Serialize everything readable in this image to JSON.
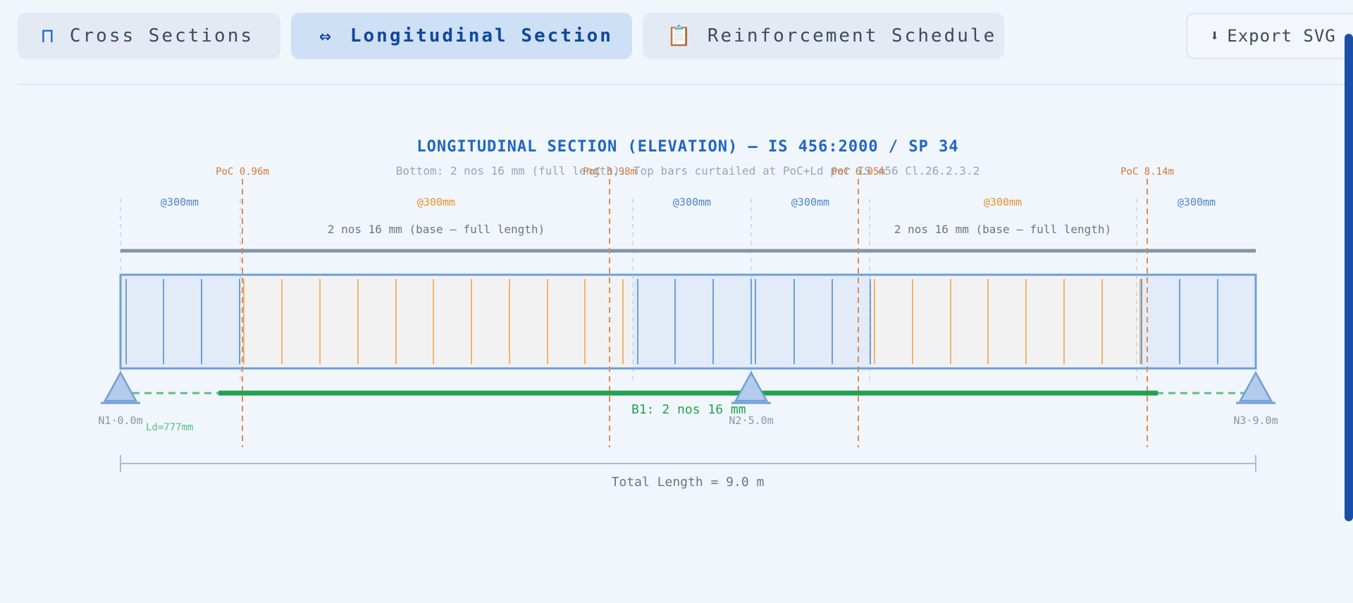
{
  "tabs": [
    {
      "icon": "⊓",
      "label": "Cross Sections"
    },
    {
      "icon": "⇔",
      "label": "Longitudinal Section"
    },
    {
      "icon": "📋",
      "label": "Reinforcement Schedule"
    }
  ],
  "export": {
    "icon": "⬇",
    "label": "Export SVG"
  },
  "diagram": {
    "title": "LONGITUDINAL SECTION (ELEVATION) — IS 456:2000 / SP 34",
    "subtitle": "Bottom: 2 nos 16 mm (full length). Top bars curtailed at PoC+Ld per IS 456 Cl.26.2.3.2",
    "spacing_labels": [
      "@300mm",
      "@300mm",
      "@300mm",
      "@300mm",
      "@300mm",
      "@300mm"
    ],
    "top_bar_labels": [
      "2 nos 16 mm (base — full length)",
      "2 nos 16 mm (base — full length)"
    ],
    "poc_labels": [
      "PoC 0.96m",
      "PoC 3.98m",
      "PoC 6.05m",
      "PoC 8.14m"
    ],
    "support_labels": [
      "N1·0.0m",
      "N2·5.0m",
      "N3·9.0m"
    ],
    "bottom_bar_label": "B1: 2 nos 16 mm",
    "ld_label": "Ld=777mm",
    "total_length_label": "Total Length = 9.0 m",
    "colors": {
      "title": "#1f66c4",
      "beam_outline": "#6fa0d8",
      "beam_fill": "#e2ebf7",
      "middle_fill": "#f2f2f2",
      "stirrup_end": "#6fa0d8",
      "stirrup_mid": "#f0b56e",
      "top_bar": "#8194a6",
      "bottom_bar": "#22a24e",
      "poc_line": "#dc8c52"
    }
  }
}
